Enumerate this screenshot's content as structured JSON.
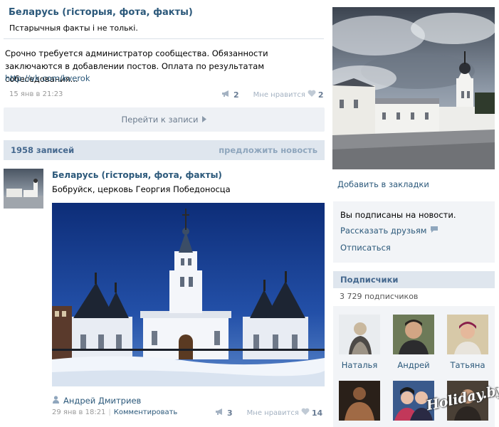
{
  "post1": {
    "group_title": "Беларусь (гісторыя, фота, факты)",
    "group_status": "Пстарычныя факты і не толькі.",
    "text": "Срочно требуется администратор сообщества. Обязанности заключаются в добавлении постов. Оплата по результатам собеседования...",
    "link": "http://vk.com/kverok",
    "date": "15 янв в 21:23",
    "reposts": "2",
    "like_label": "Мне нравится",
    "likes": "2",
    "goto_label": "Перейти к записи"
  },
  "wall_header": {
    "count_label": "1958 записей",
    "suggest_label": "предложить новость"
  },
  "post2": {
    "group_title": "Беларусь (гісторыя, фота, факты)",
    "text": "Бобруйск, церковь Георгия Победоносца",
    "author": "Андрей Дмитриев",
    "date": "29 янв в 18:21",
    "comment_label": "Комментировать",
    "reposts": "3",
    "like_label": "Мне нравится",
    "likes": "14"
  },
  "sidebar": {
    "bookmark_label": "Добавить в закладки",
    "subscribed_text": "Вы подписаны на новости.",
    "tell_friends_label": "Рассказать друзьям",
    "unsubscribe_label": "Отписаться",
    "subscribers_title": "Подписчики",
    "subscribers_count": "3 729 подписчиков",
    "subscribers": [
      {
        "name": "Наталья"
      },
      {
        "name": "Андрей"
      },
      {
        "name": "Татьяна"
      },
      {
        "name": ""
      },
      {
        "name": ""
      },
      {
        "name": ""
      }
    ]
  },
  "watermark": "Holiday.by",
  "colors": {
    "link": "#2b587a",
    "header_bg": "#dfe6ee",
    "box_bg": "#f2f4f7",
    "goto_bg": "#eef1f5"
  }
}
